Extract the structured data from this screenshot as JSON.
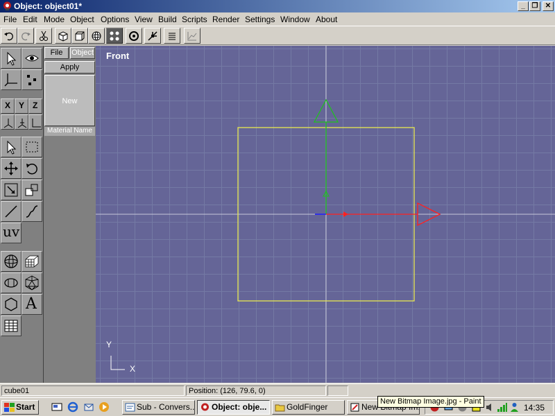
{
  "window": {
    "title": "Object: object01*",
    "minimize": "_",
    "restore": "❐",
    "close": "✕"
  },
  "menu": [
    "File",
    "Edit",
    "Mode",
    "Object",
    "Options",
    "View",
    "Build",
    "Scripts",
    "Render",
    "Settings",
    "Window",
    "About"
  ],
  "material_panel": {
    "tab_file": "File",
    "tab_object": "Object",
    "apply": "Apply",
    "new": "New",
    "material_name": "Material Name"
  },
  "tools": {
    "axis_x": "X",
    "axis_y": "Y",
    "axis_z": "Z",
    "uv": "uv",
    "text": "A"
  },
  "viewport": {
    "name": "Front",
    "axis_y_label": "Y",
    "axis_x_label": "X",
    "colors": {
      "background": "#656597",
      "grid": "#747aa4",
      "box": "#e8e850",
      "x_axis": "#ff2020",
      "y_axis": "#20c020",
      "z_axis": "#2020ff"
    }
  },
  "status": {
    "object": "cube01",
    "position": "Position: (126, 79.6, 0)",
    "extra": ""
  },
  "taskbar": {
    "start": "Start",
    "tasks": [
      "Sub - Convers...",
      "Object: obje...",
      "GoldFinger",
      "New Bitmap Im..."
    ],
    "clock": "14:35",
    "tooltip": "New Bitmap Image.jpg - Paint"
  }
}
